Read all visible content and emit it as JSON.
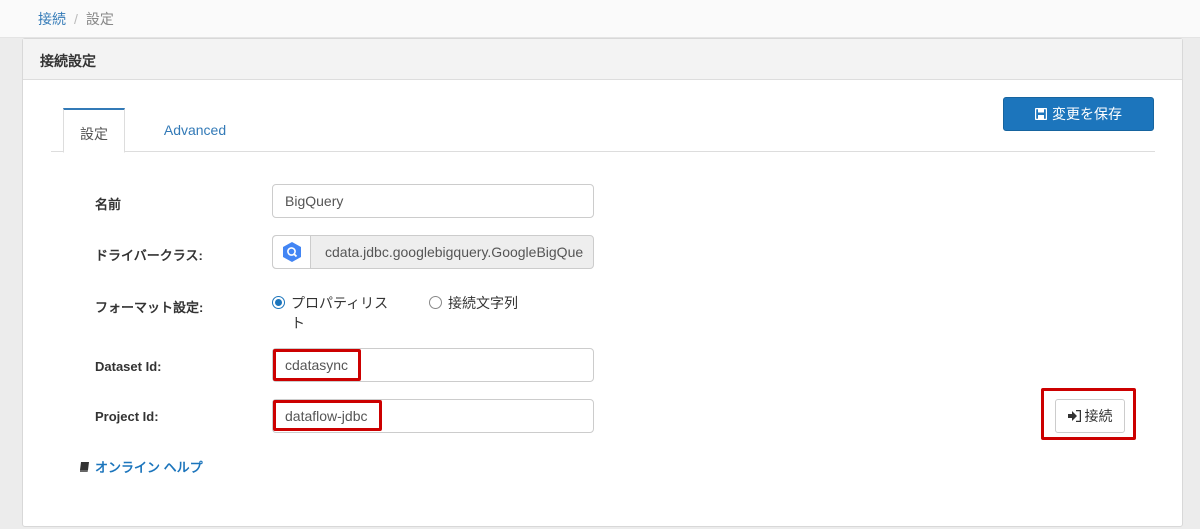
{
  "breadcrumb": {
    "parent": "接続",
    "current": "設定"
  },
  "panel": {
    "title": "接続設定"
  },
  "tabs": [
    {
      "label": "設定"
    },
    {
      "label": "Advanced"
    }
  ],
  "toolbar": {
    "save_label": "変更を保存"
  },
  "form": {
    "name": {
      "label": "名前",
      "value": "BigQuery"
    },
    "driver_class": {
      "label": "ドライバークラス:",
      "value": "cdata.jdbc.googlebigquery.GoogleBigQue"
    },
    "format": {
      "label": "フォーマット設定:",
      "options": [
        {
          "label": "プロパティリスト",
          "checked": true
        },
        {
          "label": "接続文字列",
          "checked": false
        }
      ]
    },
    "dataset_id": {
      "label": "Dataset Id:",
      "value": "cdatasync"
    },
    "project_id": {
      "label": "Project Id:",
      "value": "dataflow-jdbc"
    }
  },
  "connect_label": "接続",
  "help_label": "オンライン ヘルプ",
  "colors": {
    "primary": "#1c75bc",
    "highlight": "#cc0000",
    "google_blue": "#4285f4"
  }
}
